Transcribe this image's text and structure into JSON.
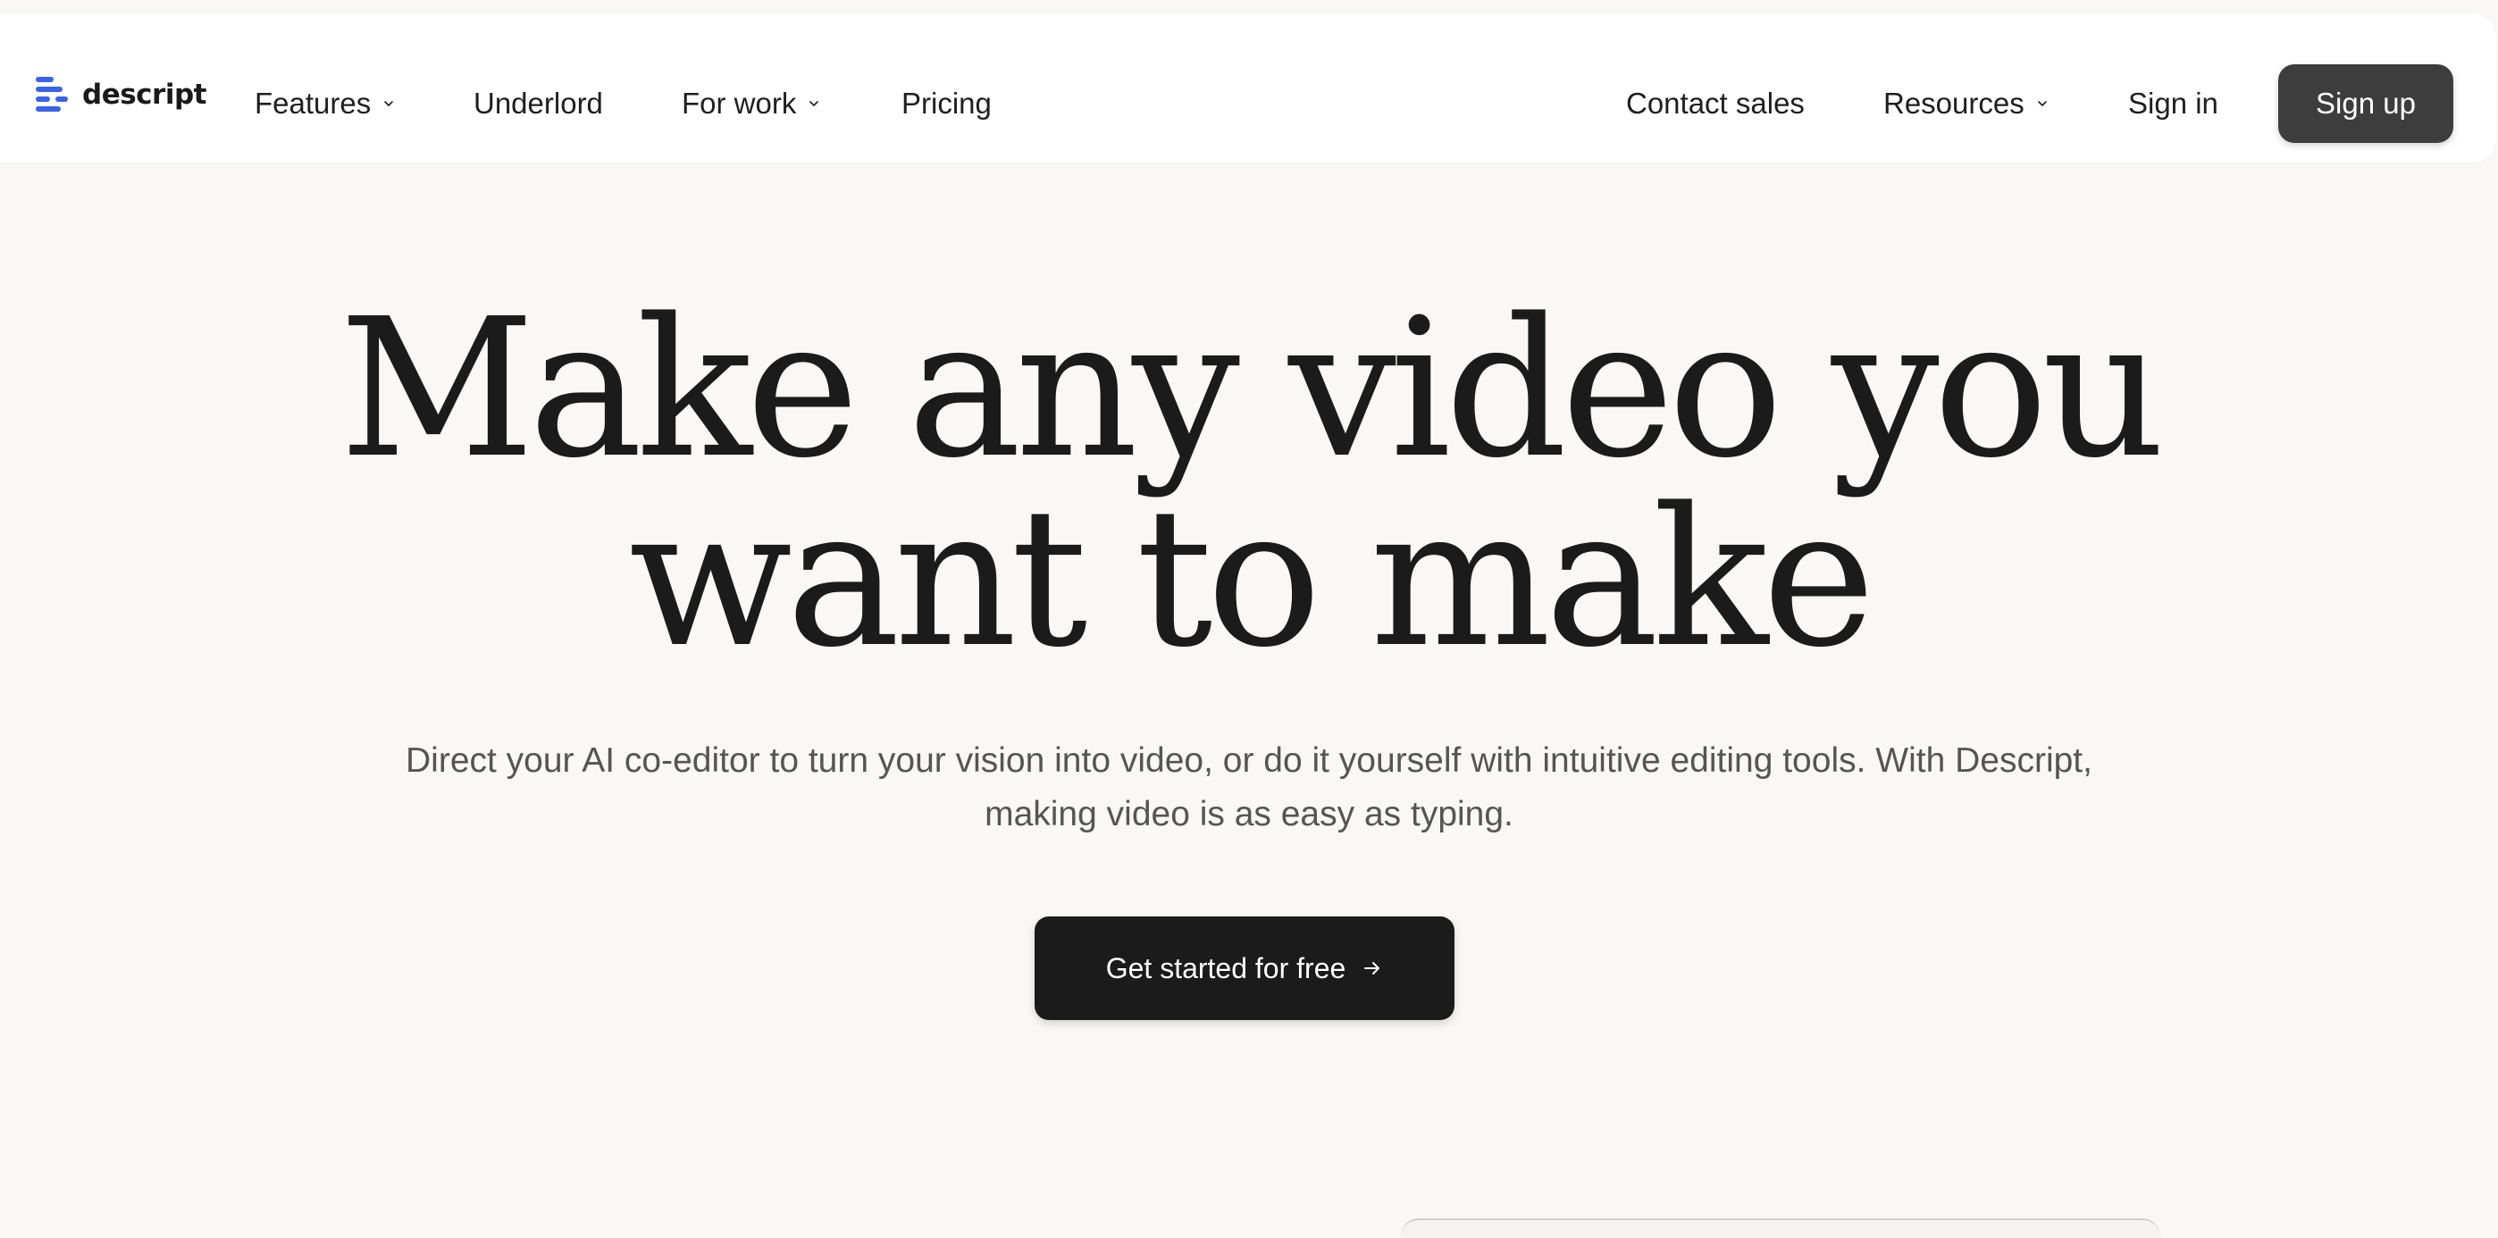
{
  "nav": {
    "logo_text": "descript",
    "brand_color": "#3b63e6",
    "items": [
      {
        "label": "Features",
        "has_dropdown": true
      },
      {
        "label": "Underlord",
        "has_dropdown": false
      },
      {
        "label": "For work",
        "has_dropdown": true
      },
      {
        "label": "Pricing",
        "has_dropdown": false
      }
    ],
    "right_items": [
      {
        "label": "Contact sales",
        "has_dropdown": false
      },
      {
        "label": "Resources",
        "has_dropdown": true
      },
      {
        "label": "Sign in",
        "has_dropdown": false
      }
    ],
    "signup_label": "Sign up"
  },
  "hero": {
    "title_line1": "Make any video you",
    "title_line2": "want to make",
    "subtitle": "Direct your AI co-editor to turn your vision into video, or do it yourself with intuitive editing tools. With Descript, making video is as easy as typing.",
    "cta_label": "Get started for free",
    "cta_icon": "arrow-right-icon"
  }
}
